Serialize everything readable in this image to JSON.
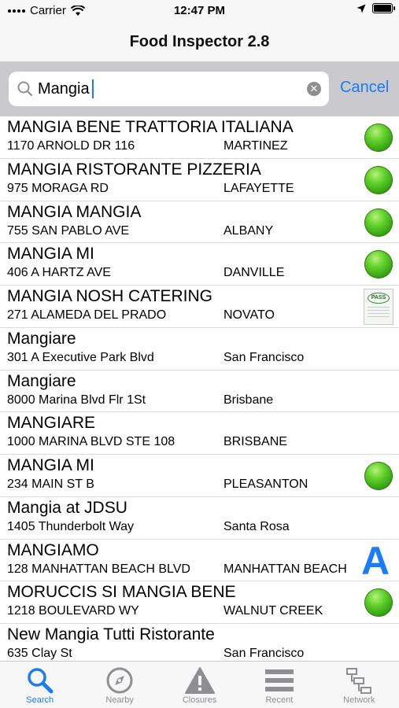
{
  "status_bar": {
    "carrier": "Carrier",
    "time": "12:47 PM"
  },
  "nav": {
    "title": "Food Inspector 2.8"
  },
  "search": {
    "value": "Mangia",
    "cancel_label": "Cancel"
  },
  "results": [
    {
      "name": "MANGIA BENE TRATTORIA ITALIANA",
      "address": "1170 ARNOLD DR 116",
      "city": "MARTINEZ",
      "badge": "green-circle"
    },
    {
      "name": "MANGIA RISTORANTE PIZZERIA",
      "address": "975 MORAGA RD",
      "city": "LAFAYETTE",
      "badge": "green-circle"
    },
    {
      "name": "MANGIA MANGIA",
      "address": "755 SAN PABLO AVE",
      "city": "ALBANY",
      "badge": "green-circle"
    },
    {
      "name": "MANGIA MI",
      "address": "406 A HARTZ AVE",
      "city": "DANVILLE",
      "badge": "green-circle"
    },
    {
      "name": "MANGIA NOSH CATERING",
      "address": "271 ALAMEDA DEL PRADO",
      "city": "NOVATO",
      "badge": "pass-placard",
      "badge_text": "PASS"
    },
    {
      "name": "Mangiare",
      "address": "301 A Executive Park Blvd",
      "city": "San Francisco",
      "badge": "none"
    },
    {
      "name": "Mangiare",
      "address": "8000 Marina Blvd Flr 1St",
      "city": "Brisbane",
      "badge": "none"
    },
    {
      "name": "MANGIARE",
      "address": "1000 MARINA BLVD STE 108",
      "city": "BRISBANE",
      "badge": "none"
    },
    {
      "name": "MANGIA MI",
      "address": "234 MAIN ST B",
      "city": "PLEASANTON",
      "badge": "green-circle"
    },
    {
      "name": "Mangia at JDSU",
      "address": "1405 Thunderbolt Way",
      "city": "Santa Rosa",
      "badge": "none"
    },
    {
      "name": "MANGIAMO",
      "address": "128 MANHATTAN BEACH BLVD",
      "city": "MANHATTAN BEACH",
      "badge": "grade-letter",
      "badge_text": "A"
    },
    {
      "name": "MORUCCIS SI MANGIA BENE",
      "address": "1218 BOULEVARD WY",
      "city": "WALNUT CREEK",
      "badge": "green-circle"
    },
    {
      "name": "New Mangia Tutti Ristorante",
      "address": "635 Clay St",
      "city": "San Francisco",
      "badge": "none"
    }
  ],
  "tabs": [
    {
      "label": "Search",
      "icon": "search-icon",
      "active": true
    },
    {
      "label": "Nearby",
      "icon": "compass-icon",
      "active": false
    },
    {
      "label": "Closures",
      "icon": "warning-icon",
      "active": false
    },
    {
      "label": "Recent",
      "icon": "list-icon",
      "active": false
    },
    {
      "label": "Network",
      "icon": "network-icon",
      "active": false
    }
  ],
  "colors": {
    "accent": "#1a7cf6",
    "pass_green": "#3fb31a",
    "inactive": "#8e8e93"
  }
}
